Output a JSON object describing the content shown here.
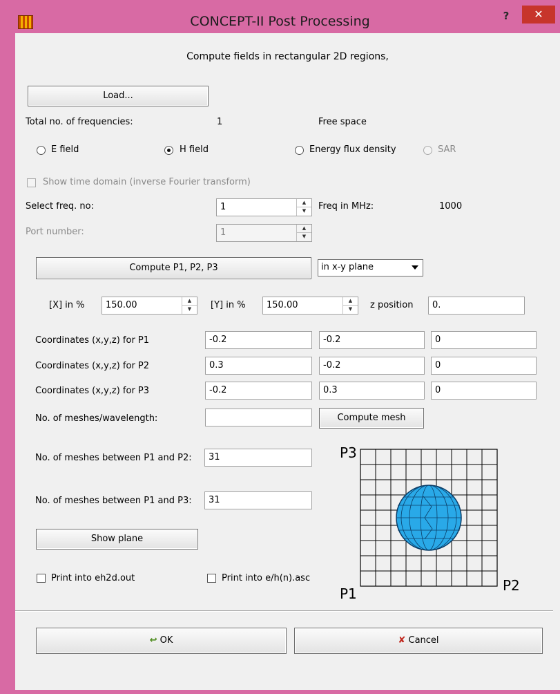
{
  "window": {
    "title": "CONCEPT-II Post Processing",
    "help": "?",
    "close": "✕"
  },
  "header": "Compute fields in rectangular 2D regions,",
  "load_button": "Load...",
  "total_freq": {
    "label": "Total no. of frequencies:",
    "value": "1",
    "medium": "Free space"
  },
  "field_options": [
    {
      "label": "E field",
      "selected": false,
      "enabled": true
    },
    {
      "label": "H field",
      "selected": true,
      "enabled": true
    },
    {
      "label": "Energy flux density",
      "selected": false,
      "enabled": true
    },
    {
      "label": "SAR",
      "selected": false,
      "enabled": false
    }
  ],
  "time_domain": {
    "label": "Show time domain (inverse Fourier transform)",
    "checked": false,
    "enabled": false
  },
  "select_freq": {
    "label": "Select freq. no:",
    "value": "1",
    "freq_label": "Freq in MHz:",
    "freq_value": "1000"
  },
  "port": {
    "label": "Port number:",
    "value": "1"
  },
  "compute_button": "Compute P1, P2, P3",
  "plane_select": "in x-y plane",
  "extent": {
    "x_label": "[X] in %",
    "x_value": "150.00",
    "y_label": "[Y] in %",
    "y_value": "150.00",
    "z_label": "z position",
    "z_value": "0."
  },
  "coords": [
    {
      "label": "Coordinates (x,y,z) for P1",
      "x": "-0.2",
      "y": "-0.2",
      "z": "0"
    },
    {
      "label": "Coordinates (x,y,z) for P2",
      "x": "0.3",
      "y": "-0.2",
      "z": "0"
    },
    {
      "label": "Coordinates (x,y,z) for P3",
      "x": "-0.2",
      "y": "0.3",
      "z": "0"
    }
  ],
  "meshes_wavelength": {
    "label": "No. of meshes/wavelength:",
    "value": ""
  },
  "compute_mesh_button": "Compute mesh",
  "meshes_p1_p2": {
    "label": "No. of meshes between P1 and P2:",
    "value": "31"
  },
  "meshes_p1_p3": {
    "label": "No. of meshes between P1 and P3:",
    "value": "31"
  },
  "show_plane_button": "Show plane",
  "print_eh2d": {
    "label": "Print into eh2d.out",
    "checked": false
  },
  "print_ehn": {
    "label": "Print into e/h(n).asc",
    "checked": false
  },
  "diagram": {
    "p1": "P1",
    "p2": "P2",
    "p3": "P3",
    "sphere_color": "#29a9e8"
  },
  "ok_button": "OK",
  "cancel_button": "Cancel"
}
